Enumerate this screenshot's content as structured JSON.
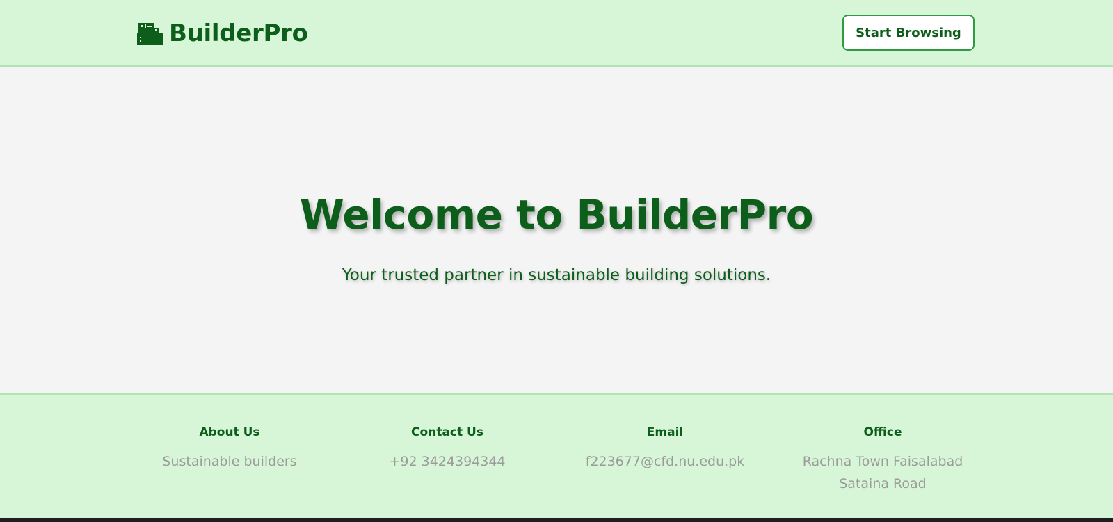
{
  "header": {
    "logo_icon": "toolbox-icon",
    "brand": "BuilderPro",
    "cta_label": "Start Browsing"
  },
  "hero": {
    "title": "Welcome to BuilderPro",
    "subtitle": "Your trusted partner in sustainable building solutions."
  },
  "footer": {
    "columns": [
      {
        "heading": "About Us",
        "text": "Sustainable builders"
      },
      {
        "heading": "Contact Us",
        "text": "+92 3424394344"
      },
      {
        "heading": "Email",
        "text": "f223677@cfd.nu.edu.pk"
      },
      {
        "heading": "Office",
        "text": "Rachna Town Faisalabad Sataina Road"
      }
    ]
  },
  "colors": {
    "brand_green": "#0d5e1b",
    "header_bg": "#d7f6d7",
    "page_bg": "#f4f4f4",
    "button_border": "#2e9a42",
    "muted_text": "#9b9b9b"
  }
}
